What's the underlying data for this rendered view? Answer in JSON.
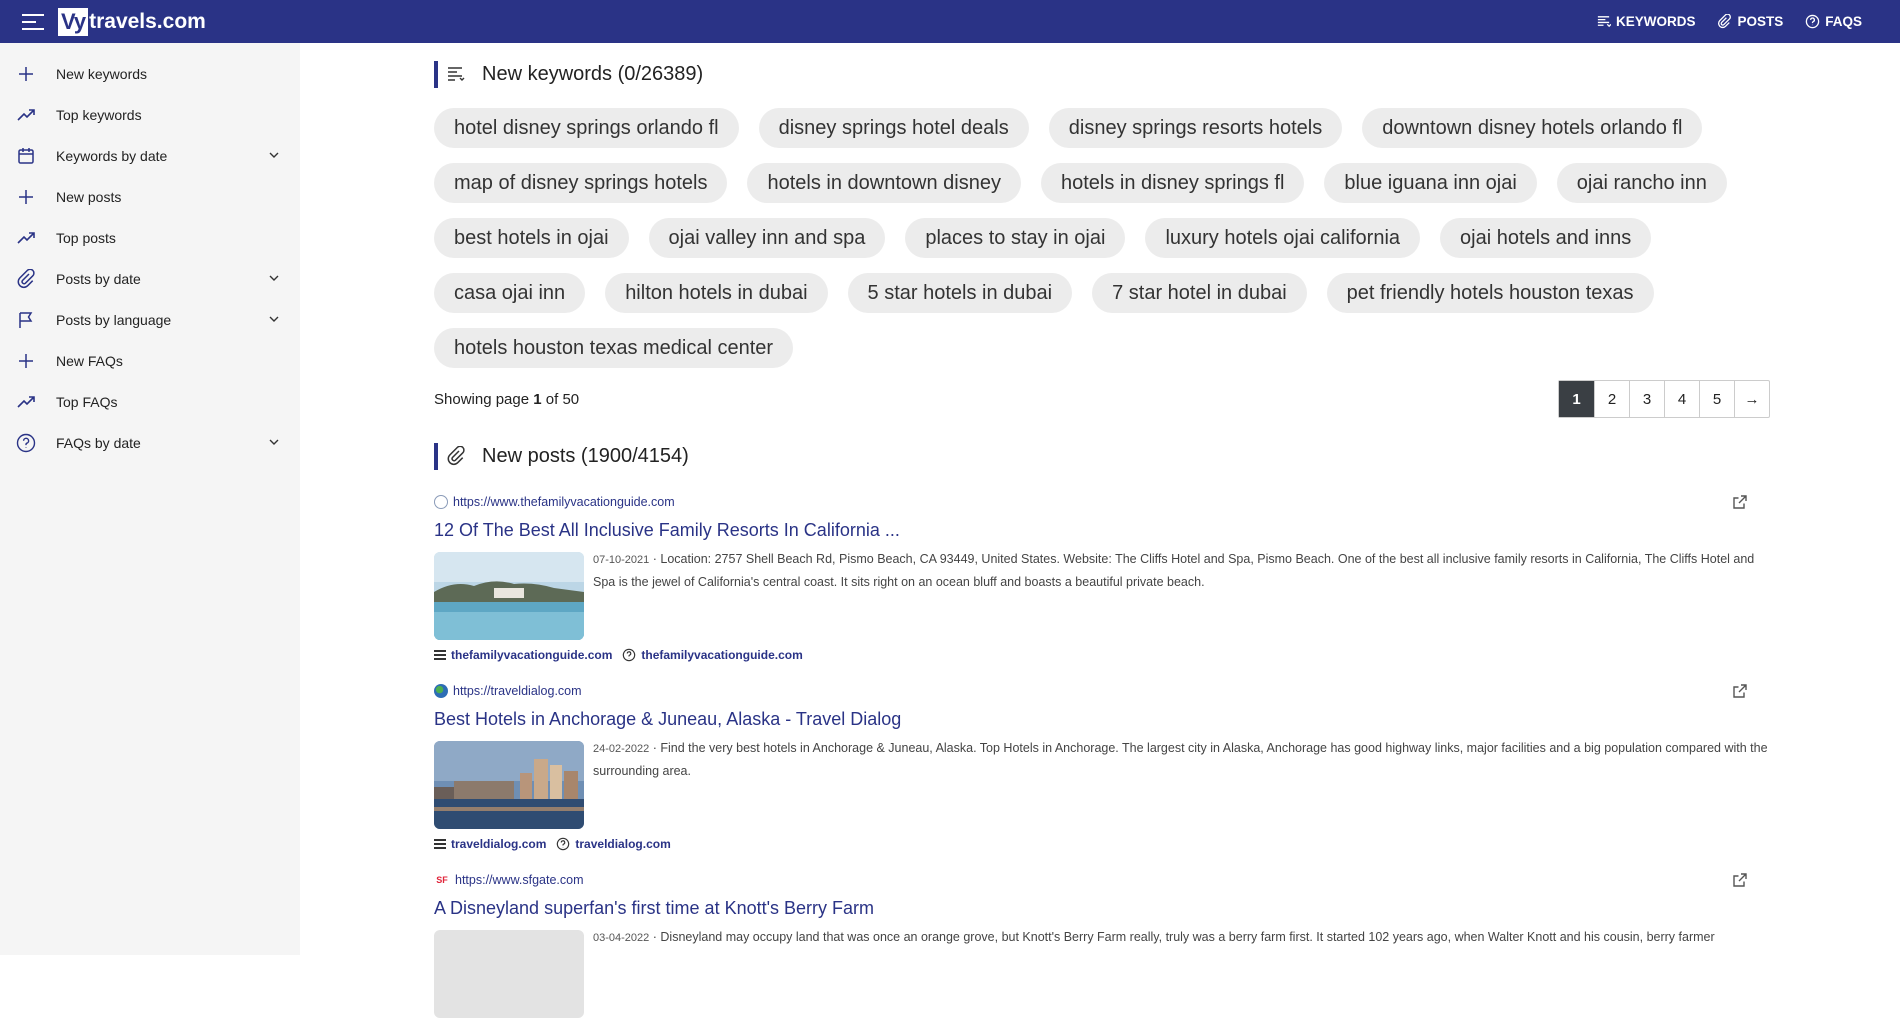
{
  "header": {
    "logo_box": "Vy",
    "logo_text": "travels.com",
    "nav": [
      {
        "label": "KEYWORDS",
        "icon": "list-icon"
      },
      {
        "label": "POSTS",
        "icon": "paperclip-icon"
      },
      {
        "label": "FAQS",
        "icon": "question-icon"
      }
    ]
  },
  "sidebar": {
    "items": [
      {
        "label": "New keywords",
        "icon": "plus-icon",
        "chevron": false
      },
      {
        "label": "Top keywords",
        "icon": "trending-icon",
        "chevron": false
      },
      {
        "label": "Keywords by date",
        "icon": "calendar-icon",
        "chevron": true
      },
      {
        "label": "New posts",
        "icon": "plus-icon",
        "chevron": false
      },
      {
        "label": "Top posts",
        "icon": "trending-icon",
        "chevron": false
      },
      {
        "label": "Posts by date",
        "icon": "paperclip-icon",
        "chevron": true
      },
      {
        "label": "Posts by language",
        "icon": "flag-icon",
        "chevron": true
      },
      {
        "label": "New FAQs",
        "icon": "plus-icon",
        "chevron": false
      },
      {
        "label": "Top FAQs",
        "icon": "trending-icon",
        "chevron": false
      },
      {
        "label": "FAQs by date",
        "icon": "question-icon",
        "chevron": true
      }
    ]
  },
  "keywords": {
    "title": "New keywords (0/26389)",
    "chips": [
      "hotel disney springs orlando fl",
      "disney springs hotel deals",
      "disney springs resorts hotels",
      "downtown disney hotels orlando fl",
      "map of disney springs hotels",
      "hotels in downtown disney",
      "hotels in disney springs fl",
      "blue iguana inn ojai",
      "ojai rancho inn",
      "best hotels in ojai",
      "ojai valley inn and spa",
      "places to stay in ojai",
      "luxury hotels ojai california",
      "ojai hotels and inns",
      "casa ojai inn",
      "hilton hotels in dubai",
      "5 star hotels in dubai",
      "7 star hotel in dubai",
      "pet friendly hotels houston texas",
      "hotels houston texas medical center"
    ],
    "pager": {
      "showing_prefix": "Showing page ",
      "current": "1",
      "of_text": " of 50",
      "pages": [
        "1",
        "2",
        "3",
        "4",
        "5",
        "→"
      ]
    }
  },
  "posts": {
    "title": "New posts (1900/4154)",
    "items": [
      {
        "url": "https://www.thefamilyvacationguide.com",
        "title": "12 Of The Best All Inclusive Family Resorts In California ...",
        "date": "07-10-2021",
        "snippet": "Location: 2757 Shell Beach Rd, Pismo Beach, CA 93449, United States. Website: The Cliffs Hotel and Spa, Pismo Beach. One of the best all inclusive family resorts in California, The Cliffs Hotel and Spa is the jewel of California's central coast. It sits right on an ocean bluff and boasts a beautiful private beach.",
        "foot_site": "thefamilyvacationguide.com",
        "foot_faq": "thefamilyvacationguide.com",
        "fav_color": "#8a9bb8"
      },
      {
        "url": "https://traveldialog.com",
        "title": "Best Hotels in Anchorage & Juneau, Alaska - Travel Dialog",
        "date": "24-02-2022",
        "snippet": "Find the very best hotels in Anchorage & Juneau, Alaska. Top Hotels in Anchorage. The largest city in Alaska, Anchorage has good highway links, major facilities and a big population compared with the surrounding area.",
        "foot_site": "traveldialog.com",
        "foot_faq": "traveldialog.com",
        "fav_color": "#2d6db5"
      },
      {
        "url": "https://www.sfgate.com",
        "title": "A Disneyland superfan's first time at Knott's Berry Farm",
        "date": "03-04-2022",
        "snippet": "Disneyland may occupy land that was once an orange grove, but Knott's Berry Farm really, truly was a berry farm first. It started 102 years ago, when Walter Knott and his cousin, berry farmer",
        "foot_site": "",
        "foot_faq": "",
        "fav_color": "#e0243a"
      }
    ]
  },
  "colors": {
    "brand": "#2a3386",
    "chip_bg": "#ececec",
    "sidebar_bg": "#f5f5f5",
    "pager_active": "#3a3f44"
  }
}
